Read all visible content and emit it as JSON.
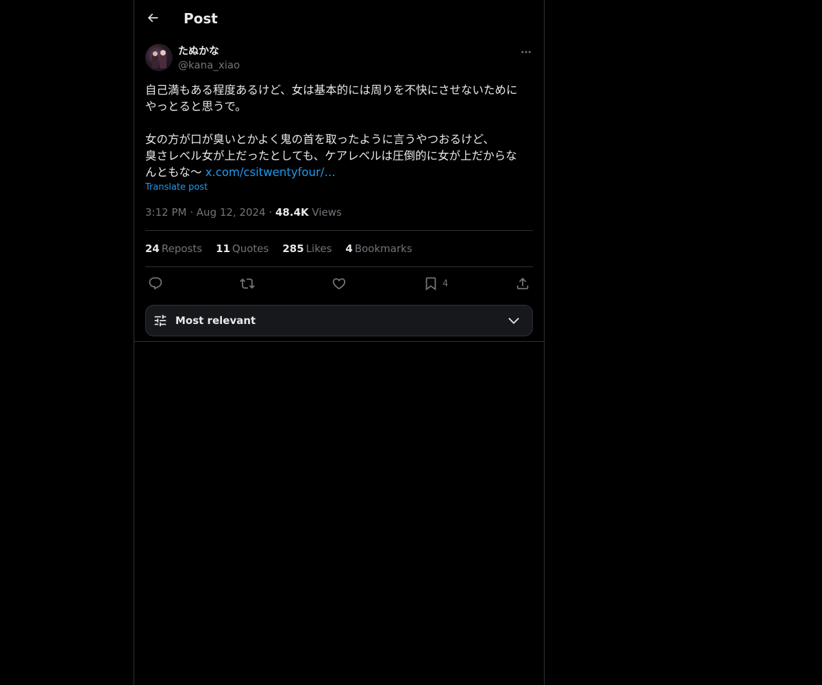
{
  "header": {
    "title": "Post",
    "back_icon": "arrow-left-icon"
  },
  "post": {
    "author": {
      "display_name": "たぬかな",
      "handle": "@kana_xiao",
      "avatar_icon": "avatar-photo"
    },
    "text_line1": "自己満もある程度あるけど、女は基本的には周りを不快にさせないために",
    "text_line2": "やっとると思うで。",
    "text_line3": "女の方が口が臭いとかよく鬼の首を取ったように言うやつおるけど、",
    "text_line4": "臭さレベル女が上だったとしても、ケアレベルは圧倒的に女が上だからな",
    "text_line5": "んともな〜 ",
    "link": "x.com/csitwentyfour/…",
    "translate_label": "Translate post",
    "time": "3:12 PM",
    "date": "Aug 12, 2024",
    "separator": "·",
    "views_count": "48.4K",
    "views_label": "Views"
  },
  "stats": {
    "reposts_count": "24",
    "reposts_label": "Reposts",
    "quotes_count": "11",
    "quotes_label": "Quotes",
    "likes_count": "285",
    "likes_label": "Likes",
    "bookmarks_count": "4",
    "bookmarks_label": "Bookmarks"
  },
  "actions": {
    "reply_icon": "reply-icon",
    "repost_icon": "repost-icon",
    "like_icon": "heart-icon",
    "bookmark_icon": "bookmark-icon",
    "bookmark_count": "4",
    "share_icon": "share-icon"
  },
  "sort": {
    "label": "Most relevant",
    "icon": "tune-icon",
    "chevron": "chevron-down-icon"
  },
  "colors": {
    "background": "#000000",
    "text": "#e7e9ea",
    "muted": "#71767b",
    "link": "#1d9bf0",
    "border": "#2f3336"
  }
}
